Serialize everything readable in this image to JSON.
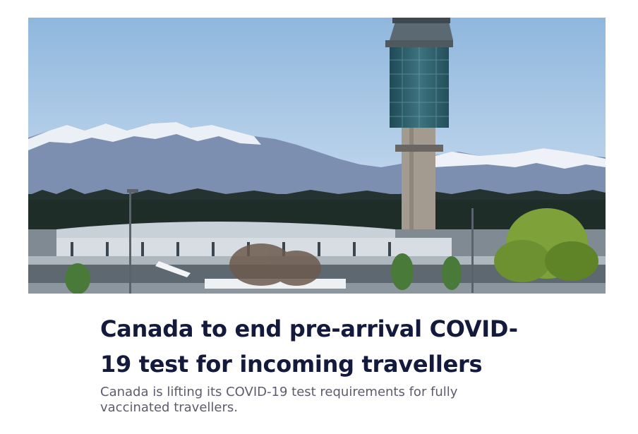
{
  "article": {
    "image_alt": "",
    "title": "Canada to end pre-arrival COVID-19 test for incoming travellers",
    "summary": "Canada is lifting its COVID-19 test requirements for fully vaccinated travellers."
  }
}
